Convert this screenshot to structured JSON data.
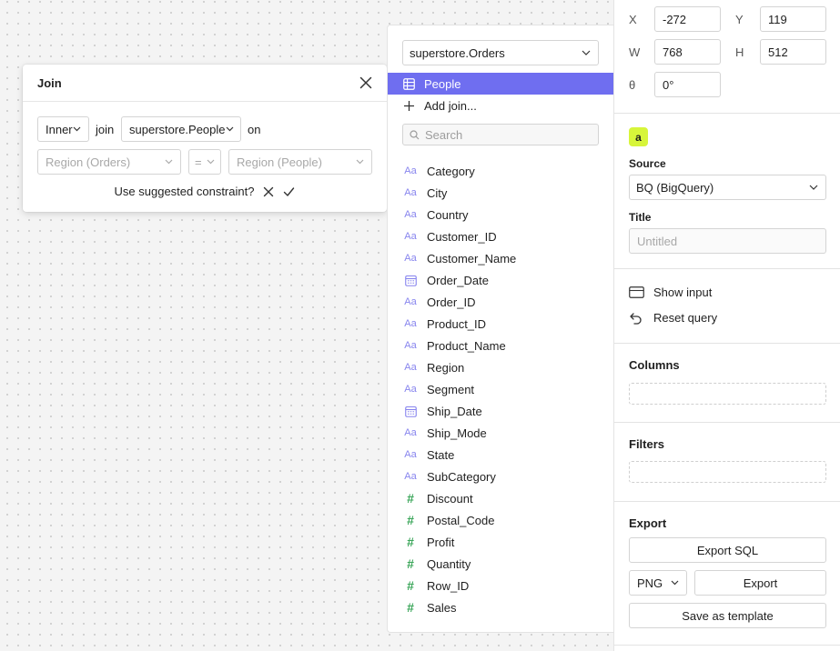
{
  "join_popover": {
    "title": "Join",
    "join_type": "Inner",
    "join_word": "join",
    "target_table": "superstore.People",
    "on_word": "on",
    "left_field_placeholder": "Region (Orders)",
    "operator": "=",
    "right_field_placeholder": "Region (People)",
    "suggest_text": "Use suggested constraint?"
  },
  "table_panel": {
    "table": "superstore.Orders",
    "selected_item": "People",
    "add_join_label": "Add join...",
    "search_placeholder": "Search",
    "fields": [
      {
        "name": "Category",
        "type": "text"
      },
      {
        "name": "City",
        "type": "text"
      },
      {
        "name": "Country",
        "type": "text"
      },
      {
        "name": "Customer_ID",
        "type": "text"
      },
      {
        "name": "Customer_Name",
        "type": "text"
      },
      {
        "name": "Order_Date",
        "type": "date"
      },
      {
        "name": "Order_ID",
        "type": "text"
      },
      {
        "name": "Product_ID",
        "type": "text"
      },
      {
        "name": "Product_Name",
        "type": "text"
      },
      {
        "name": "Region",
        "type": "text"
      },
      {
        "name": "Segment",
        "type": "text"
      },
      {
        "name": "Ship_Date",
        "type": "date"
      },
      {
        "name": "Ship_Mode",
        "type": "text"
      },
      {
        "name": "State",
        "type": "text"
      },
      {
        "name": "SubCategory",
        "type": "text"
      },
      {
        "name": "Discount",
        "type": "number"
      },
      {
        "name": "Postal_Code",
        "type": "number"
      },
      {
        "name": "Profit",
        "type": "number"
      },
      {
        "name": "Quantity",
        "type": "number"
      },
      {
        "name": "Row_ID",
        "type": "number"
      },
      {
        "name": "Sales",
        "type": "number"
      }
    ],
    "text_icon_glyph": "Aa",
    "number_icon_glyph": "#"
  },
  "properties": {
    "x_label": "X",
    "x_value": "-272",
    "y_label": "Y",
    "y_value": "119",
    "w_label": "W",
    "w_value": "768",
    "h_label": "H",
    "h_value": "512",
    "theta_label": "θ",
    "theta_value": "0°",
    "badge": "a",
    "source_label": "Source",
    "source_value": "BQ (BigQuery)",
    "title_label": "Title",
    "title_placeholder": "Untitled",
    "show_input_label": "Show input",
    "reset_query_label": "Reset query",
    "columns_label": "Columns",
    "filters_label": "Filters",
    "export_label": "Export",
    "export_sql_label": "Export SQL",
    "format_value": "PNG",
    "export_button_label": "Export",
    "save_template_label": "Save as template"
  },
  "colors": {
    "accent": "#6f6ef0",
    "badge_bg": "#d7f53a",
    "text_icon": "#8784ee",
    "number_icon": "#3ba65a"
  }
}
